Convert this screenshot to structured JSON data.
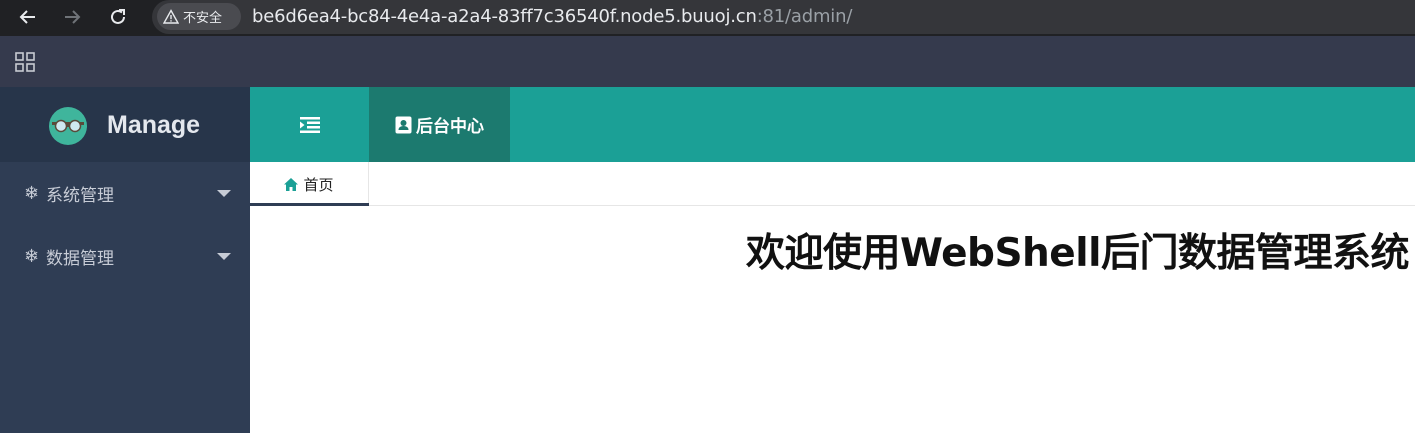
{
  "browser": {
    "security_label": "不安全",
    "url_host": "be6d6ea4-bc84-4e4a-a2a4-83ff7c36540f.node5.buuoj.cn",
    "url_path": ":81/admin/",
    "icons": [
      "back-arrow-icon",
      "forward-arrow-icon",
      "reload-icon",
      "warning-icon",
      "apps-grid-icon"
    ]
  },
  "brand": {
    "name": "Manage"
  },
  "sidebar": {
    "items": [
      {
        "label": "系统管理",
        "icon": "snowflake-icon"
      },
      {
        "label": "数据管理",
        "icon": "snowflake-icon"
      }
    ]
  },
  "header": {
    "tab_label": "后台中心",
    "tab_icon": "address-card-icon",
    "toggle_icon": "indent-icon"
  },
  "tabs": {
    "home_label": "首页",
    "home_icon": "home-icon"
  },
  "main": {
    "welcome": "欢迎使用WebShell后门数据管理系统"
  },
  "colors": {
    "header_teal": "#1ba096",
    "header_tab_active": "#1c7a6f",
    "sidebar_bg": "#2f3d54",
    "brand_bg": "#27354a",
    "browser_bar": "#202124",
    "bookmarks_bar": "#353a4d"
  }
}
